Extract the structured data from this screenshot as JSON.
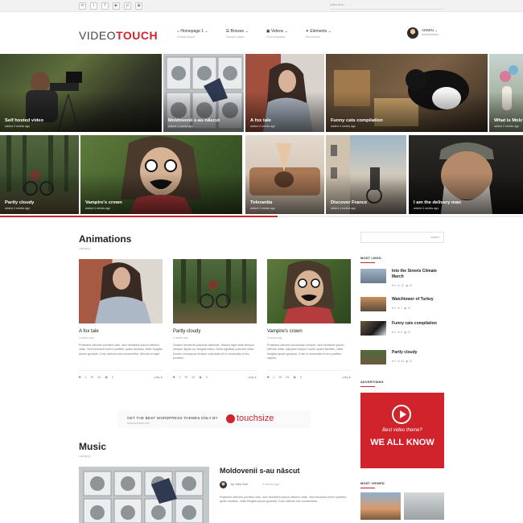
{
  "colors": {
    "accent": "#d0232c"
  },
  "topbar": {
    "social_icons": [
      "mail-icon",
      "twitter-icon",
      "facebook-icon",
      "video-icon",
      "pinterest-icon",
      "rss-icon"
    ],
    "search_placeholder": "enter text..."
  },
  "header": {
    "logo_part1": "VIDEO",
    "logo_part2": "TOUCH",
    "nav": [
      {
        "label": "Homepage 1",
        "sub": "Default layout"
      },
      {
        "label": "Browse",
        "sub": "Sample pages"
      },
      {
        "label": "Videos",
        "sub": "Post templates"
      },
      {
        "label": "Elements",
        "sub": "Shortcodes"
      }
    ],
    "user_name": "ADMIN",
    "user_role": "Administrator"
  },
  "tiles": [
    {
      "title": "Self hosted video",
      "date": "added 4 weeks ago"
    },
    {
      "title": "Moldovenii s-au născut",
      "date": "added 4 weeks ago"
    },
    {
      "title": "A fox tale",
      "date": "added 4 weeks ago"
    },
    {
      "title": "Funny cats compilation",
      "date": "added 4 weeks ago"
    },
    {
      "title": "What is Molz",
      "date": "added 4 weeks ago"
    },
    {
      "title": "Partly cloudy",
      "date": "added 4 weeks ago"
    },
    {
      "title": "Vampire's crown",
      "date": "added 4 weeks ago"
    },
    {
      "title": "Tolerantia",
      "date": "added 4 weeks ago"
    },
    {
      "title": "Discover France",
      "date": "added 4 weeks ago"
    },
    {
      "title": "I am the delivery man",
      "date": "added 4 weeks ago"
    }
  ],
  "slider_progress": 0.53,
  "animations": {
    "title": "Animations",
    "subtitle": "category",
    "cards": [
      {
        "title": "A fox tale",
        "date": "4 weeks ago",
        "excerpt": "Praesent ultricies porttitor odio, sed hendrerit ipsum efficitur vitae. Sed tincidunt lorem porttitor quam facilisis, vitae fringilla ipsum gravida. Cras ultrices nisi consectetur. Mauris et eget",
        "likes": "2",
        "comments": "44",
        "views": "0",
        "play": "play"
      },
      {
        "title": "Partly cloudy",
        "date": "4 weeks ago",
        "excerpt": "Nullam hendrerit placerat dictumst. Mauris eget ante tempor, semper ligula eu, feugiat tellus. Nulla egestas posuere dolor. Donec consequat tempor vulputate et in venenatis et leo porttitor.",
        "likes": "2",
        "comments": "44",
        "views": "0",
        "play": "play"
      },
      {
        "title": "Vampire's crown",
        "date": "4 weeks ago",
        "excerpt": "Praesent ultricies accumsan tempor, sed hendrerit ipsum efficitur vitae. Aliquam tempor lorem quam facilisis, vitae fringilla ipsum gravida. Cras in venenatis et leo porttitor sapien.",
        "likes": "2",
        "comments": "28",
        "views": "0",
        "play": "play"
      }
    ]
  },
  "banner": {
    "text": "GET THE BEST WORDPRESS THEMES ONLY BY",
    "sub": "www.touchsize.com",
    "brand": "touchsize"
  },
  "music": {
    "title": "Music",
    "subtitle": "category",
    "post_title": "Moldovenii s-au născut",
    "author": "by John Doe",
    "date": "4 weeks ago",
    "excerpt": "Praesent ultricies porttitor odio, sed hendrerit ipsum efficitur vitae. Sed tincidunt lorem porttitor quam facilisis, vitae fringilla ipsum gravida. Cras ultrices nisi consectetur."
  },
  "sidebar": {
    "search_button": "search",
    "most_liked_title": "MOST LIKED",
    "most_liked": [
      {
        "title": "Into the Streets Climate March",
        "likes": "0",
        "comments": "12",
        "views": "12"
      },
      {
        "title": "Watchtower of Turkey",
        "likes": "0",
        "comments": "7",
        "views": "12"
      },
      {
        "title": "Funny cats compilation",
        "likes": "0",
        "comments": "5",
        "views": "12"
      },
      {
        "title": "Partly cloudy",
        "likes": "0",
        "comments": "44",
        "views": "12"
      }
    ],
    "advertising_title": "ADVERTISING",
    "ad_line1": "Best video theme?",
    "ad_line2": "WE ALL KNOW",
    "most_viewed_title": "MOST VIEWED"
  }
}
